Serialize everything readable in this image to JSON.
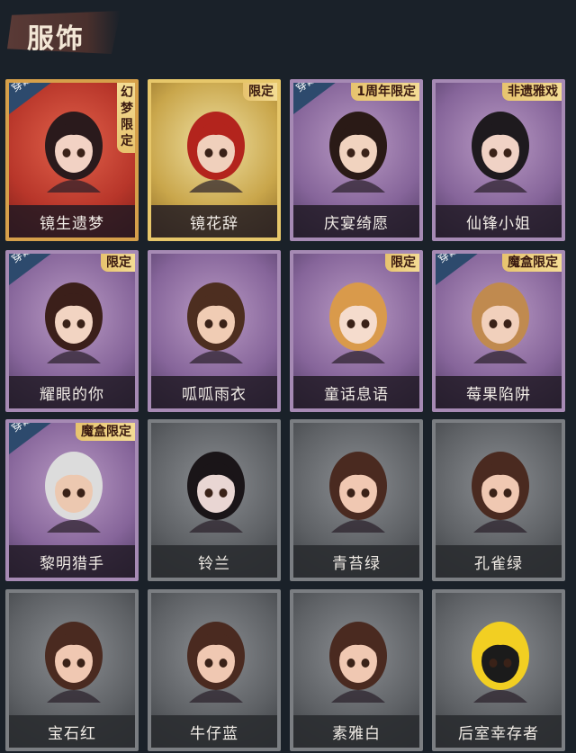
{
  "header": {
    "title": "服饰"
  },
  "badges": {
    "wear": "穿戴"
  },
  "costumes": [
    {
      "name": "镜生遗梦",
      "rarity": "red",
      "worn": true,
      "tag": "幻梦限定",
      "tag_vertical": true,
      "hair": "#2a1a1c",
      "skin": "#f2d2c4"
    },
    {
      "name": "镜花辞",
      "rarity": "gold",
      "worn": false,
      "tag": "限定",
      "tag_vertical": false,
      "hair": "#b3241d",
      "skin": "#f0d0bc"
    },
    {
      "name": "庆宴绮愿",
      "rarity": "purple",
      "worn": true,
      "tag": "1周年限定",
      "tag_vertical": false,
      "hair": "#2a1a16",
      "skin": "#f1d3bf"
    },
    {
      "name": "仙锋小姐",
      "rarity": "purple",
      "worn": false,
      "tag": "非遗雅戏",
      "tag_vertical": false,
      "hair": "#1e1a1e",
      "skin": "#f0d2c5"
    },
    {
      "name": "耀眼的你",
      "rarity": "purple",
      "worn": true,
      "tag": "限定",
      "tag_vertical": false,
      "hair": "#3b1f1a",
      "skin": "#f2d4c2"
    },
    {
      "name": "呱呱雨衣",
      "rarity": "purple",
      "worn": false,
      "tag": "",
      "tag_vertical": false,
      "hair": "#4d2e20",
      "skin": "#f0ccb4"
    },
    {
      "name": "童话息语",
      "rarity": "purple",
      "worn": false,
      "tag": "限定",
      "tag_vertical": false,
      "hair": "#d99a4b",
      "skin": "#f5dccd"
    },
    {
      "name": "莓果陷阱",
      "rarity": "purple",
      "worn": true,
      "tag": "魔盒限定",
      "tag_vertical": false,
      "hair": "#c08a4f",
      "skin": "#f1d0bc"
    },
    {
      "name": "黎明猎手",
      "rarity": "purple",
      "worn": true,
      "tag": "魔盒限定",
      "tag_vertical": false,
      "hair": "#dcdcdc",
      "skin": "#ecc8b0"
    },
    {
      "name": "铃兰",
      "rarity": "gray",
      "worn": false,
      "tag": "",
      "tag_vertical": false,
      "hair": "#1a1518",
      "skin": "#e9d6d3"
    },
    {
      "name": "青苔绿",
      "rarity": "gray",
      "worn": false,
      "tag": "",
      "tag_vertical": false,
      "hair": "#4a2a20",
      "skin": "#f0c8b2"
    },
    {
      "name": "孔雀绿",
      "rarity": "gray",
      "worn": false,
      "tag": "",
      "tag_vertical": false,
      "hair": "#4a2a20",
      "skin": "#f0c8b2"
    },
    {
      "name": "宝石红",
      "rarity": "gray",
      "worn": false,
      "tag": "",
      "tag_vertical": false,
      "hair": "#4a2a20",
      "skin": "#f0c8b2"
    },
    {
      "name": "牛仔蓝",
      "rarity": "gray",
      "worn": false,
      "tag": "",
      "tag_vertical": false,
      "hair": "#4a2a20",
      "skin": "#f0c8b2"
    },
    {
      "name": "素雅白",
      "rarity": "gray",
      "worn": false,
      "tag": "",
      "tag_vertical": false,
      "hair": "#4a2a20",
      "skin": "#f0c8b2"
    },
    {
      "name": "后室幸存者",
      "rarity": "gray",
      "worn": false,
      "tag": "",
      "tag_vertical": false,
      "hair": "#f2cf22",
      "skin": "#1b1b1b"
    }
  ]
}
